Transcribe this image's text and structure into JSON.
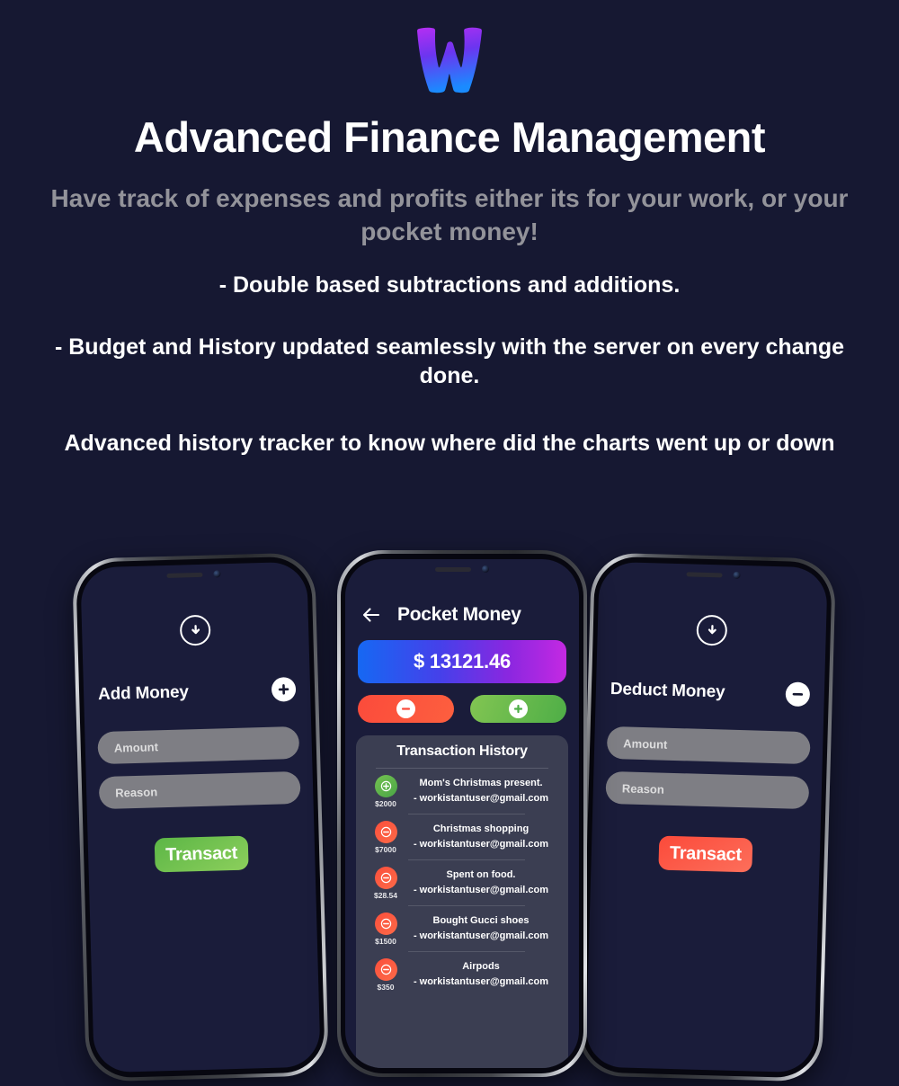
{
  "brand": {
    "logo_letter": "W",
    "gradient_from": "#a22ef0",
    "gradient_to": "#1a8bff"
  },
  "hero": {
    "title": "Advanced Finance Management",
    "subtitle": "Have track of expenses and profits either its for your work, or your pocket money!",
    "features": [
      "- Double based subtractions and additions.",
      "- Budget and History updated seamlessly with the server on every change done.",
      "Advanced history tracker to know where did the charts went up or down"
    ]
  },
  "phones": {
    "left": {
      "screen_title": "Add Money",
      "header_icon": "download-circle-icon",
      "action_icon": "plus-circle-icon",
      "fields": [
        {
          "name": "amount-input",
          "placeholder": "Amount",
          "value": ""
        },
        {
          "name": "reason-input",
          "placeholder": "Reason",
          "value": ""
        }
      ],
      "submit_label": "Transact",
      "submit_color": "#5cb646"
    },
    "center": {
      "app_title": "Pocket Money",
      "back_icon": "arrow-left-icon",
      "balance": "$ 13121.46",
      "balance_gradient_from": "#1668f3",
      "balance_gradient_to": "#c429e2",
      "deduct_button_icon": "minus-circle-icon",
      "add_button_icon": "plus-circle-icon",
      "history_title": "Transaction History",
      "transactions": [
        {
          "type": "credit",
          "amount": "$2000",
          "label": "Mom's Christmas present.",
          "account": "- workistantuser@gmail.com"
        },
        {
          "type": "debit",
          "amount": "$7000",
          "label": "Christmas shopping",
          "account": "- workistantuser@gmail.com"
        },
        {
          "type": "debit",
          "amount": "$28.54",
          "label": "Spent on food.",
          "account": "- workistantuser@gmail.com"
        },
        {
          "type": "debit",
          "amount": "$1500",
          "label": "Bought Gucci shoes",
          "account": "- workistantuser@gmail.com"
        },
        {
          "type": "debit",
          "amount": "$350",
          "label": "Airpods",
          "account": "- workistantuser@gmail.com"
        }
      ]
    },
    "right": {
      "screen_title": "Deduct Money",
      "header_icon": "download-circle-icon",
      "action_icon": "minus-circle-icon",
      "fields": [
        {
          "name": "amount-input",
          "placeholder": "Amount",
          "value": ""
        },
        {
          "name": "reason-input",
          "placeholder": "Reason",
          "value": ""
        }
      ],
      "submit_label": "Transact",
      "submit_color": "#fb4a3a"
    }
  }
}
